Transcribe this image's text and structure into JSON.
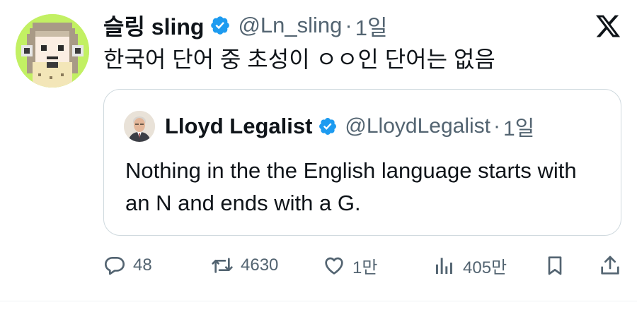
{
  "tweet": {
    "author": {
      "name": "슬링 sling",
      "handle": "@Ln_sling",
      "separator": "·",
      "time": "1일",
      "verified": true,
      "avatar_icon": "pixel-girl-avatar"
    },
    "text": "한국어 단어 중 초성이 ㅇㅇ인 단어는 없음",
    "quote": {
      "author": {
        "name": "Lloyd Legalist",
        "handle": "@LloydLegalist",
        "separator": "·",
        "time": "1일",
        "verified": true,
        "avatar_icon": "man-portrait-avatar"
      },
      "text": "Nothing in the the English language starts with an N and ends with a G."
    },
    "actions": {
      "reply": {
        "icon": "reply-icon",
        "count": "48"
      },
      "repost": {
        "icon": "repost-icon",
        "count": "4630"
      },
      "like": {
        "icon": "heart-icon",
        "count": "1만"
      },
      "views": {
        "icon": "views-icon",
        "count": "405만"
      },
      "bookmark": {
        "icon": "bookmark-icon"
      },
      "share": {
        "icon": "share-icon"
      }
    }
  },
  "colors": {
    "text": "#0f1419",
    "muted": "#536471",
    "verified": "#1d9bf0",
    "border": "#cfd9de",
    "avatar_bg": "#c2f063"
  }
}
